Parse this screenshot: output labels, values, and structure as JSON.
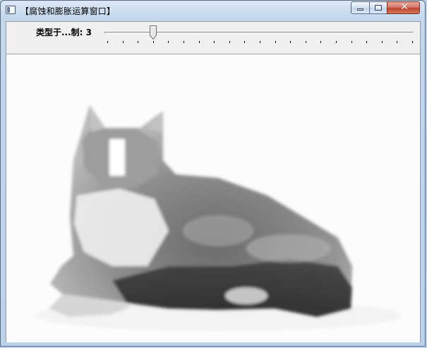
{
  "window": {
    "title": "【腐蚀和膨胀运算窗口】",
    "icon": "app-window-icon",
    "controls": {
      "minimize": "minimize-icon",
      "maximize": "maximize-icon",
      "close": "✕"
    }
  },
  "trackbar": {
    "label": "类型于...制: 3",
    "value": 3,
    "min": 0,
    "max": 20,
    "tick_count": 21
  },
  "image": {
    "subject": "cat-icon",
    "background": "#ffffff"
  }
}
